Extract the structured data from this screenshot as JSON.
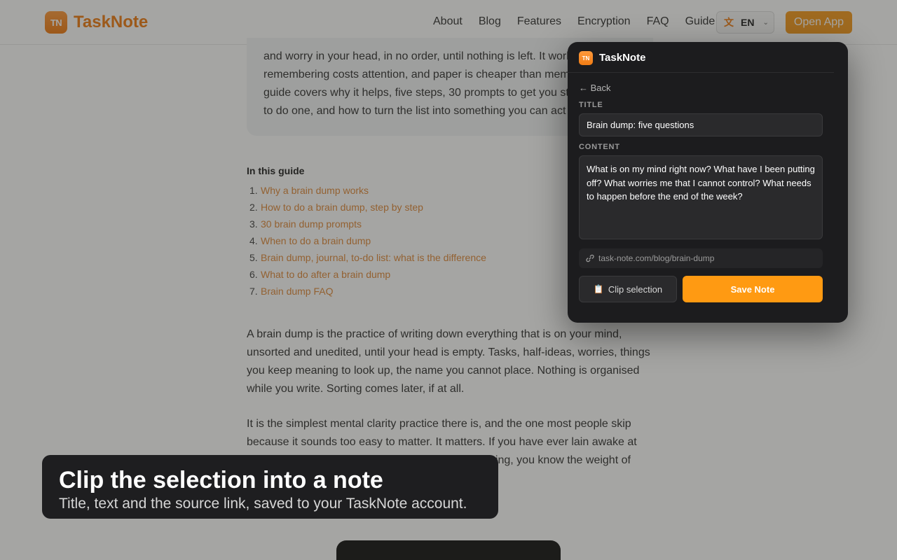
{
  "site": {
    "logo_text": "TN",
    "name": "TaskNote",
    "nav": [
      "About",
      "Blog",
      "Features",
      "Encryption",
      "FAQ",
      "Guide"
    ],
    "language": "EN",
    "open_app_label": "Open App"
  },
  "article": {
    "summary": "and worry in your head, in no order, until nothing is left. It works because remembering costs attention, and paper is cheaper than memory. This guide covers why it helps, five steps, 30 prompts to get you started, when to do one, and how to turn the list into something you can act on.",
    "toc_title": "In this guide",
    "toc": [
      {
        "num": "1.",
        "label": "Why a brain dump works"
      },
      {
        "num": "2.",
        "label": "How to do a brain dump, step by step"
      },
      {
        "num": "3.",
        "label": "30 brain dump prompts"
      },
      {
        "num": "4.",
        "label": "When to do a brain dump"
      },
      {
        "num": "5.",
        "label": "Brain dump, journal, to-do list: what is the difference"
      },
      {
        "num": "6.",
        "label": "What to do after a brain dump"
      },
      {
        "num": "7.",
        "label": "Brain dump FAQ"
      }
    ],
    "paragraph_1": "A brain dump is the practice of writing down everything that is on your mind, unsorted and unedited, until your head is empty. Tasks, half-ideas, worries, things you keep meaning to look up, the name you cannot place. Nothing is organised while you write. Sorting comes later, if at all.",
    "paragraph_2": "It is the simplest mental clarity practice there is, and the one most people skip because it sounds too easy to matter. It matters. If you have ever lain awake at night feeling exhausted without having done anything, you know the weight of unfinished things in your head. A"
  },
  "popup": {
    "logo_text": "TN",
    "title": "TaskNote",
    "back_label": "← Back",
    "title_label": "TITLE",
    "title_value": "Brain dump: five questions",
    "content_label": "CONTENT",
    "content_value": "What is on my mind right now? What have I been putting off? What worries me that I cannot control? What needs to happen before the end of the week?",
    "source_url": "task-note.com/blog/brain-dump",
    "clip_label": "Clip selection",
    "save_label": "Save Note"
  },
  "caption": {
    "title": "Clip the selection into a note",
    "subtitle": "Title, text and the source link, saved to your TaskNote account."
  },
  "colors": {
    "brand": "#f07c14",
    "save_button": "#ff9a12",
    "popup_bg": "#1c1c1e",
    "toc_link": "#e08a3c"
  }
}
